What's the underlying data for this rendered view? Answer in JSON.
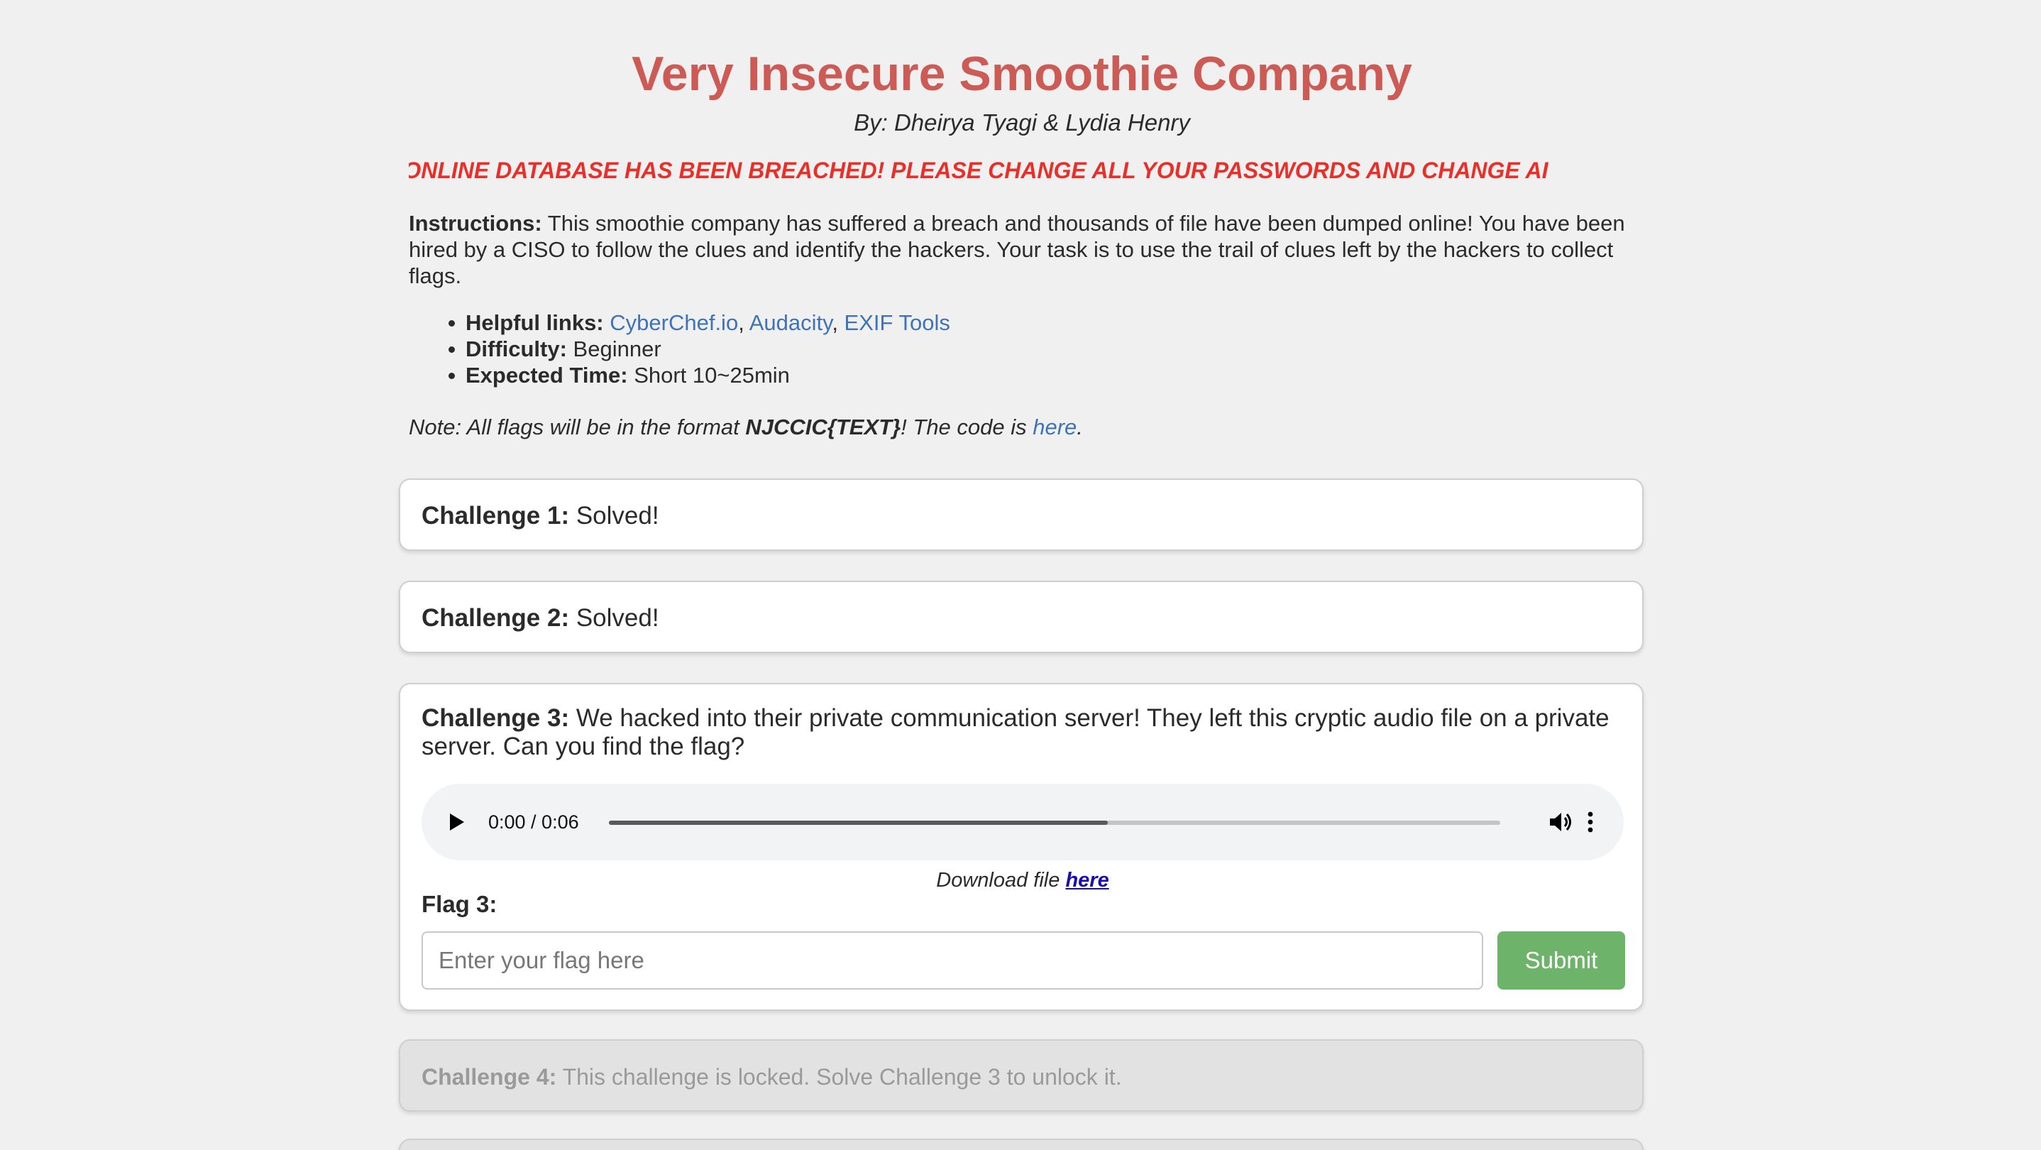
{
  "header": {
    "title": "Very Insecure Smoothie Company",
    "byline": "By: Dheirya Tyagi & Lydia Henry",
    "alert": "'T: OUR ONLINE DATABASE HAS BEEN BREACHED! PLEASE CHANGE ALL YOUR PASSWORDS AND CHANGE AI"
  },
  "instructions": {
    "label": "Instructions:",
    "text": " This smoothie company has suffered a breach and thousands of file have been dumped online! You have been hired by a CISO to follow the clues and identify the hackers. Your task is to use the trail of clues left by the hackers to collect flags."
  },
  "info": {
    "helpful_label": "Helpful links:",
    "links": [
      "CyberChef.io",
      "Audacity",
      "EXIF Tools"
    ],
    "sep": ", ",
    "difficulty_label": "Difficulty:",
    "difficulty": " Beginner",
    "time_label": "Expected Time:",
    "time": " Short 10~25min"
  },
  "note": {
    "prefix": "Note: All flags will be in the format ",
    "format": "NJCCIC{TEXT}",
    "middle": "! The code is ",
    "link": "here",
    "suffix": "."
  },
  "challenges": [
    {
      "label": "Challenge 1:",
      "text": " Solved!"
    },
    {
      "label": "Challenge 2:",
      "text": " Solved!"
    },
    {
      "label": "Challenge 3:",
      "text": " We hacked into their private communication server! They left this cryptic audio file on a private server. Can you find the flag?",
      "audio": {
        "time": "0:00 / 0:06",
        "buffered_fraction": 0.56
      },
      "download_prefix": "Download file ",
      "download_link": "here",
      "flag_label": "Flag 3:",
      "flag_placeholder": "Enter your flag here",
      "submit": "Submit"
    },
    {
      "label": "Challenge 4:",
      "text": " This challenge is locked. Solve Challenge 3 to unlock it."
    }
  ],
  "colors": {
    "title": "#cc5a55",
    "alert": "#e8302a",
    "link": "#3f73b5",
    "submit": "#6db36a",
    "background": "#f0f0f0"
  }
}
